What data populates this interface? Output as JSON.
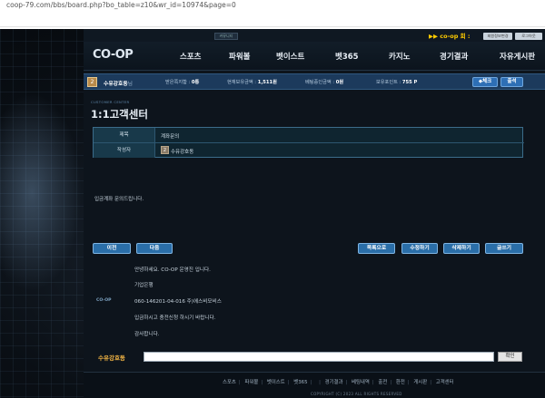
{
  "browser": {
    "url": "coop-79.com/bbs/board.php?bo_table=z10&wr_id=10974&page=0"
  },
  "header": {
    "tiny_tab": "커뮤니티",
    "coop_link": "▶▶ co-op 회 :",
    "top_pills": [
      "회원정보변경",
      "로그아웃"
    ],
    "logo": "CO-OP",
    "nav": [
      "스포츠",
      "파워볼",
      "벳이스트",
      "벳365",
      "카지노",
      "경기결과",
      "자유게시판"
    ]
  },
  "status": {
    "level": "2",
    "username": "수유강호동",
    "username_suffix": "님",
    "stats": [
      {
        "label": "받은쪽지함 :",
        "value": "0통"
      },
      {
        "label": "현재보유금액 :",
        "value": "1,511원"
      },
      {
        "label": "베팅중인금액 :",
        "value": "0원"
      },
      {
        "label": "보유포인트 :",
        "value": "755 P"
      }
    ],
    "checkin_label": "◆체크",
    "attend_label": "출석"
  },
  "page": {
    "subheading": "CUSTOMER CENTER",
    "title": "1:1고객센터"
  },
  "post": {
    "subject_label": "제목",
    "subject_value": "계좌문의",
    "author_label": "작성자",
    "author_level": "2",
    "author_value": "수유강호동",
    "body": "입금계좌 문의드립니다."
  },
  "actions": {
    "prev": "이전",
    "next": "다음",
    "list": "목록으로",
    "edit": "수정하기",
    "delete": "삭제하기",
    "write": "글쓰기"
  },
  "reply": {
    "logo": "CO-OP",
    "lines": [
      "안녕하세요. CO-OP 운영진 입니다.",
      "기업은행",
      "060-146201-04-016 주)에스비모비스",
      "입금하시고 충전신청 하시기 바랍니다.",
      "감사합니다."
    ]
  },
  "comment": {
    "name": "수유강호동",
    "button": "확인"
  },
  "footer": {
    "links": [
      "스포츠",
      "파워볼",
      "벳이스트",
      "벳365",
      "",
      "경기결과",
      "베팅내역",
      "출전",
      "환전",
      "게시판",
      "고객센터"
    ],
    "copyright": "COPYRIGHT (C) 2023 ALL RIGHTS RESERVED"
  },
  "colors": {
    "status_bar": "#1c3a5c",
    "action_button": "#2a6ea8",
    "comment_name": "#f2b544",
    "coop_link": "#ffcc00"
  }
}
